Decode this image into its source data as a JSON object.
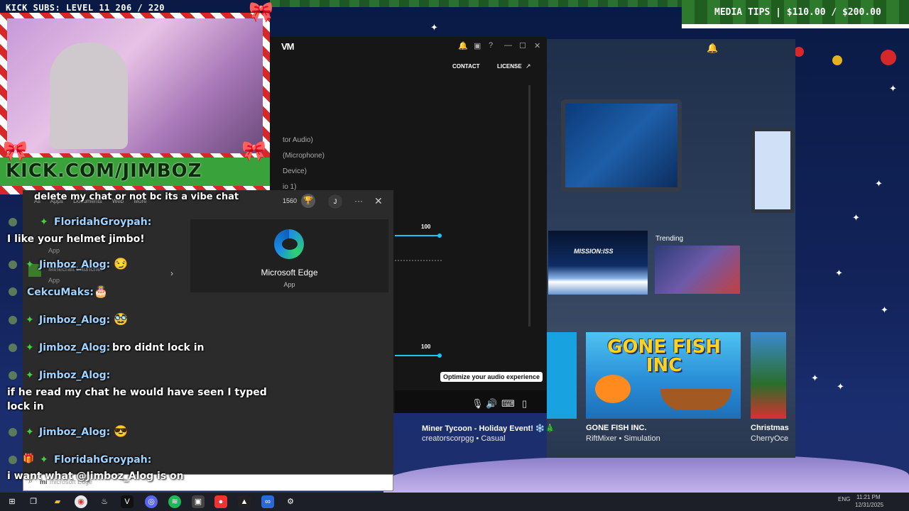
{
  "overlay": {
    "kick_subs": "KICK SUBS: LEVEL 11 206 / 220",
    "media_tips": "MEDIA TIPS | $110.00 / $200.00",
    "kick_url": "KICK.COM/JIMBOZ"
  },
  "voicemod": {
    "logo": "VM",
    "contact": "CONTACT",
    "license": "LICENSE",
    "devices": [
      "tor Audio)",
      "(Microphone)",
      "Device)",
      "io 1)"
    ],
    "slider1_value": "100",
    "slider2_value": "100",
    "tooltip": "Optimize your audio experience"
  },
  "search": {
    "tabs": "All Apps Documents Web More",
    "count": "1560",
    "avatar_initial": "J",
    "best_match_name": "Microsoft Edge",
    "best_match_type": "App",
    "list_items": [
      {
        "label": "App"
      },
      {
        "label": "Minecraft Launcher"
      },
      {
        "label": "App"
      }
    ],
    "query": "microsoft Edge",
    "typed": "mi"
  },
  "chat": {
    "messages": [
      {
        "text": "delete my chat or not bc its a vibe chat"
      },
      {
        "name": "FloridahGroypah:"
      },
      {
        "text": "I like your helmet jimbo!"
      },
      {
        "name": "Jimboz_Alog:"
      },
      {
        "name": "CekcuMaks:"
      },
      {
        "name": "Jimboz_Alog:"
      },
      {
        "name": "Jimboz_Alog:",
        "text": "bro didnt lock in"
      },
      {
        "name": "Jimboz_Alog:"
      },
      {
        "text": "if he read my chat he would have seen I typed"
      },
      {
        "text": "lock in"
      },
      {
        "name": "Jimboz_Alog:"
      },
      {
        "name": "FloridahGroypah:"
      },
      {
        "text": "i want what @Jimboz_Alog is on"
      }
    ]
  },
  "games": {
    "trending_label": "Trending",
    "mission_label": "MISSION:ISS",
    "gone_fish_art": "GONE FISH INC",
    "cards": [
      {
        "title": "Miner Tycoon - Holiday Event! ❄️🎄",
        "sub": "creatorscorpgg • Casual"
      },
      {
        "title": "GONE FISH INC.",
        "sub": "RiftMixer • Simulation"
      },
      {
        "title": "Christmas",
        "sub": "CherryOce"
      }
    ]
  },
  "taskbar": {
    "lang": "ENG",
    "time": "11:21 PM",
    "date": "12/31/2025"
  },
  "colors": {
    "accent": "#1dc3ff",
    "kick_green": "#3aa23a",
    "chat_name": "#9fd3ff"
  }
}
